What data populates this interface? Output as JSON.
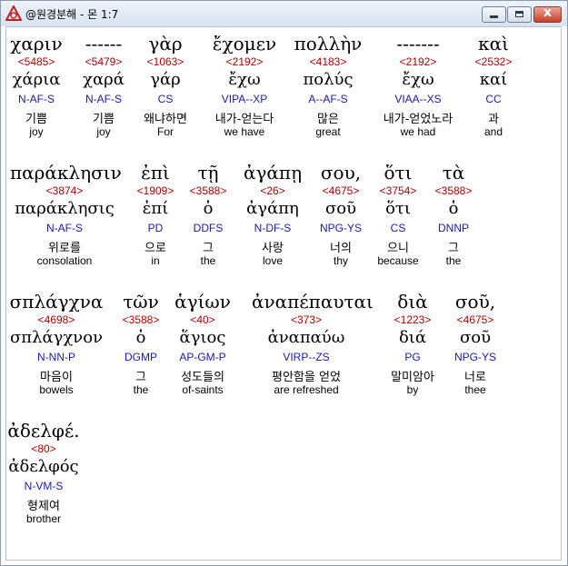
{
  "window": {
    "title": "@원경분해 - 몬 1:7",
    "minimize_label": "minimize",
    "maximize_label": "maximize",
    "close_label": "close",
    "close_glyph": "x"
  },
  "rows": [
    [
      {
        "greek": "χαριν",
        "strong": "<5485>",
        "lemma": "χάρια",
        "parse": "N-AF-S",
        "korean": "기쁨",
        "english": "joy"
      },
      {
        "greek": "------",
        "strong": "<5479>",
        "lemma": "χαρά",
        "parse": "N-AF-S",
        "korean": "기쁨",
        "english": "joy"
      },
      {
        "greek": "γὰρ",
        "strong": "<1063>",
        "lemma": "γάρ",
        "parse": "CS",
        "korean": "왜냐하면",
        "english": "For"
      },
      {
        "greek": "ἔχομεν",
        "strong": "<2192>",
        "lemma": "ἔχω",
        "parse": "VIPA--XP",
        "korean": "내가-얻는다",
        "english": "we have"
      },
      {
        "greek": "πολλὴν",
        "strong": "<4183>",
        "lemma": "πολύς",
        "parse": "A--AF-S",
        "korean": "많은",
        "english": "great"
      },
      {
        "greek": "-------",
        "strong": "<2192>",
        "lemma": "ἔχω",
        "parse": "VIAA--XS",
        "korean": "내가-얻었노라",
        "english": "we had"
      },
      {
        "greek": "καὶ",
        "strong": "<2532>",
        "lemma": "καί",
        "parse": "CC",
        "korean": "과",
        "english": "and"
      }
    ],
    [
      {
        "greek": "παράκλησιν",
        "strong": "<3874>",
        "lemma": "παράκλησις",
        "parse": "N-AF-S",
        "korean": "위로를",
        "english": "consolation"
      },
      {
        "greek": "ἐπὶ",
        "strong": "<1909>",
        "lemma": "ἐπί",
        "parse": "PD",
        "korean": "으로",
        "english": "in"
      },
      {
        "greek": "τῇ",
        "strong": "<3588>",
        "lemma": "ὁ",
        "parse": "DDFS",
        "korean": "그",
        "english": "the"
      },
      {
        "greek": "ἀγάπῃ",
        "strong": "<26>",
        "lemma": "ἀγάπη",
        "parse": "N-DF-S",
        "korean": "사랑",
        "english": "love"
      },
      {
        "greek": "σου,",
        "strong": "<4675>",
        "lemma": "σοῦ",
        "parse": "NPG-YS",
        "korean": "너의",
        "english": "thy"
      },
      {
        "greek": "ὅτι",
        "strong": "<3754>",
        "lemma": "ὅτι",
        "parse": "CS",
        "korean": "으니",
        "english": "because"
      },
      {
        "greek": "τὰ",
        "strong": "<3588>",
        "lemma": "ὁ",
        "parse": "DNNP",
        "korean": "그",
        "english": "the"
      }
    ],
    [
      {
        "greek": "σπλάγχνα",
        "strong": "<4698>",
        "lemma": "σπλάγχνον",
        "parse": "N-NN-P",
        "korean": "마음이",
        "english": "bowels"
      },
      {
        "greek": "τῶν",
        "strong": "<3588>",
        "lemma": "ὁ",
        "parse": "DGMP",
        "korean": "그",
        "english": "the"
      },
      {
        "greek": "ἁγίων",
        "strong": "<40>",
        "lemma": "ἅγιος",
        "parse": "AP-GM-P",
        "korean": "성도들의",
        "english": "of-saints"
      },
      {
        "greek": "ἀναπέπαυται",
        "strong": "<373>",
        "lemma": "ἀναπαύω",
        "parse": "VIRP--ZS",
        "korean": "평안함을 얻었",
        "english": "are refreshed"
      },
      {
        "greek": "διὰ",
        "strong": "<1223>",
        "lemma": "διά",
        "parse": "PG",
        "korean": "말미암아",
        "english": "by"
      },
      {
        "greek": "σοῦ,",
        "strong": "<4675>",
        "lemma": "σοῦ",
        "parse": "NPG-YS",
        "korean": "너로",
        "english": "thee"
      }
    ],
    [
      {
        "greek": "ἀδελφέ.",
        "strong": "<80>",
        "lemma": "ἀδελφός",
        "parse": "N-VM-S",
        "korean": "형제여",
        "english": "brother"
      }
    ]
  ]
}
